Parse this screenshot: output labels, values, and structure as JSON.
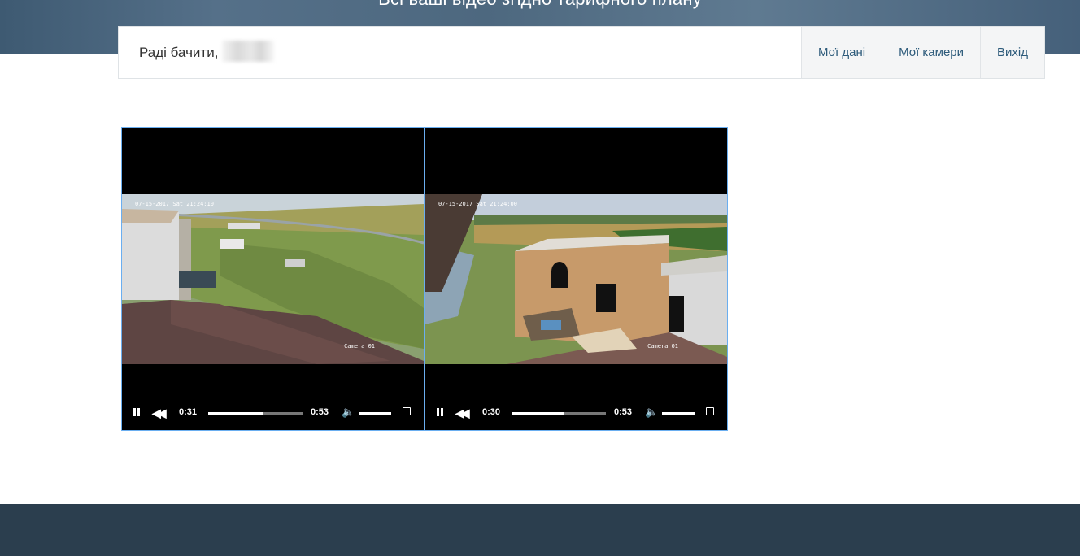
{
  "hero": {
    "title": "Всі ваші відео згідно тарифного плану"
  },
  "header": {
    "greeting": "Раді бачити,",
    "nav": [
      {
        "label": "Мої дані"
      },
      {
        "label": "Мої камери"
      },
      {
        "label": "Вихід"
      }
    ]
  },
  "videos": [
    {
      "timestamp": "07-15-2017 Sat 21:24:10",
      "camera_label": "Camera 01",
      "current_time": "0:31",
      "duration": "0:53",
      "progress": 0.58
    },
    {
      "timestamp": "07-15-2017 Sat 21:24:00",
      "camera_label": "Camera 01",
      "current_time": "0:30",
      "duration": "0:53",
      "progress": 0.56
    }
  ],
  "icons": [
    "pause-icon",
    "rewind-icon",
    "volume-icon",
    "fullscreen-icon"
  ],
  "colors": {
    "accent": "#6aaef0",
    "nav_text": "#2c5a7a",
    "footer": "#2b3e4e"
  }
}
